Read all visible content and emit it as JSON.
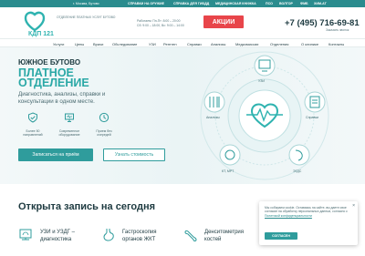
{
  "topbar": {
    "address": "г. Москва, Бутово",
    "links": [
      "СПРАВКИ НА ОРУЖИЕ",
      "СПРАВКА ДЛЯ ГИБДД",
      "МЕДИЦИНСКАЯ КНИЖКА",
      "ПСО",
      "ВОЛГОР",
      "ФМБ",
      "ХИМ-АТ"
    ]
  },
  "header": {
    "logo_text": "КДП 121",
    "org_name": "ОТДЕЛЕНИЕ ПЛАТНЫХ УСЛУГ БУТОВО",
    "hours_line1": "Работаем: Пн-Пт: 8:00 – 20:00",
    "hours_line2": "Сб: 9:00 – 18:00, Вс: 9:00 – 14:00",
    "promo_label": "АКЦИИ",
    "phone": "+7 (495) 716-69-81",
    "callback": "Заказать звонок"
  },
  "nav": {
    "items": [
      "Услуги",
      "Цены",
      "Врачи",
      "Обследование",
      "УЗИ",
      "Рентген",
      "Справки",
      "Анализы",
      "Медкомиссии",
      "Отделения",
      "О клинике",
      "Контакты"
    ]
  },
  "hero": {
    "title_small": "ЮЖНОЕ БУТОВО",
    "title_big_line1": "ПЛАТНОЕ",
    "title_big_line2": "ОТДЕЛЕНИЕ",
    "subtitle": "Диагностика, анализы, справки и консультации в одном месте.",
    "features": [
      {
        "icon": "shield-check-icon",
        "line1": "Более 50",
        "line2": "направлений"
      },
      {
        "icon": "monitor-icon",
        "line1": "Современное",
        "line2": "оборудование"
      },
      {
        "icon": "clock-icon",
        "line1": "Прием без",
        "line2": "очередей"
      }
    ],
    "cta_primary": "Записаться на приём",
    "cta_secondary": "Узнать стоимость",
    "diagram_labels": {
      "top": "УЗИ",
      "left": "Анализы",
      "right": "Справки",
      "bottom_left": "КТ, МРТ",
      "bottom_right": "ЭГДС"
    }
  },
  "section": {
    "title": "Открыта запись на сегодня",
    "services": [
      {
        "icon": "ultrasound-icon",
        "line1": "УЗИ и УЗДГ –",
        "line2": "диагностика"
      },
      {
        "icon": "stomach-icon",
        "line1": "Гастроскопия",
        "line2": "органов ЖКТ"
      },
      {
        "icon": "densitometer-icon",
        "line1": "Денситометрия",
        "line2": "костей"
      }
    ]
  },
  "cookie": {
    "text": "Мы собираем cookie. Оставаясь на сайте, вы даете свое согласие на обработку персональных данных, согласно с",
    "link": "Политикой конфиденциальности",
    "button": "СОГЛАСЕН",
    "close": "×"
  },
  "colors": {
    "accent": "#2f9c9c",
    "promo": "#e8454a",
    "text": "#1d3a40"
  }
}
